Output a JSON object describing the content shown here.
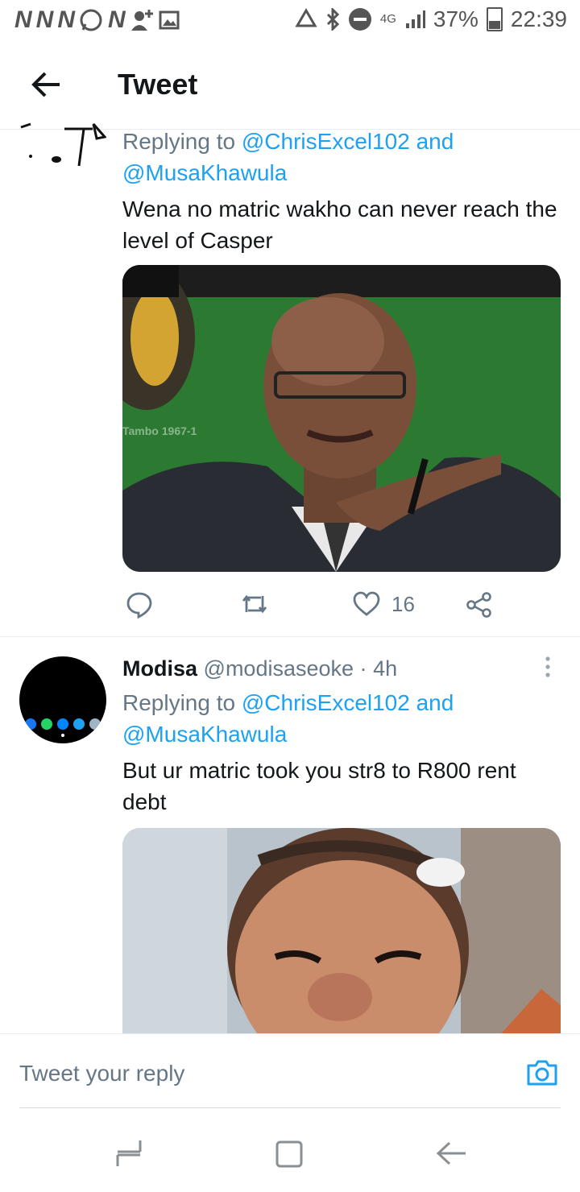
{
  "status_bar": {
    "left_letters": [
      "N",
      "N",
      "N",
      "N"
    ],
    "battery": "37%",
    "time": "22:39",
    "network": "4G"
  },
  "header": {
    "title": "Tweet"
  },
  "tweet1": {
    "replying_prefix": "Replying to",
    "mention1": "@ChrisExcel102",
    "and": "and",
    "mention2": "@MusaKhawula",
    "text": "Wena no matric wakho can never reach the level of Casper",
    "photo_caption": "Tambo 1967-1",
    "likes": "16"
  },
  "tweet2": {
    "name": "Modisa",
    "handle": "@modisaseoke",
    "dot": "·",
    "time": "4h",
    "replying_prefix": "Replying to",
    "mention1": "@ChrisExcel102",
    "and": "and",
    "mention2": "@MusaKhawula",
    "text": "But ur matric took you str8 to R800 rent debt"
  },
  "reply": {
    "placeholder": "Tweet your reply"
  },
  "colors": {
    "accent": "#1da1f2",
    "secondary_text": "#657786"
  }
}
